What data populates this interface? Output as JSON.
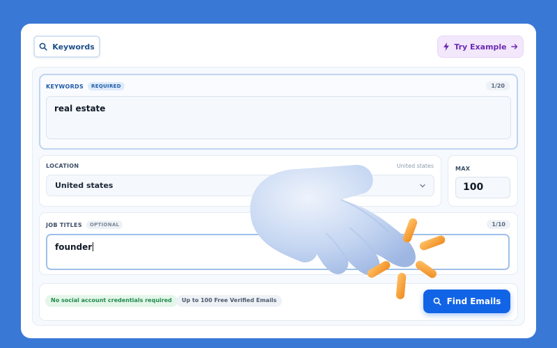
{
  "header": {
    "keywords_button": "Keywords",
    "try_example_button": "Try Example"
  },
  "keywords": {
    "label": "KEYWORDS",
    "badge": "REQUIRED",
    "counter": "1/20",
    "value": "real estate"
  },
  "location": {
    "label": "LOCATION",
    "hint": "United states",
    "selected": "United states"
  },
  "max": {
    "label": "MAX",
    "value": "100"
  },
  "job_titles": {
    "label": "JOB TITLES",
    "badge": "OPTIONAL",
    "counter": "1/10",
    "value": "founder"
  },
  "footer": {
    "pill_no_credentials": "No social account credentials required",
    "pill_free_emails": "Up to 100 Free Verified Emails",
    "find_button": "Find Emails"
  },
  "colors": {
    "background": "#3a78d6",
    "primary": "#1264e6",
    "accent_purple": "#6c2bb4",
    "success_green": "#1f8a4a"
  },
  "icons": [
    "search-icon",
    "lightning-icon",
    "arrow-right-icon",
    "chevron-down-icon",
    "pointing-hand-icon"
  ]
}
